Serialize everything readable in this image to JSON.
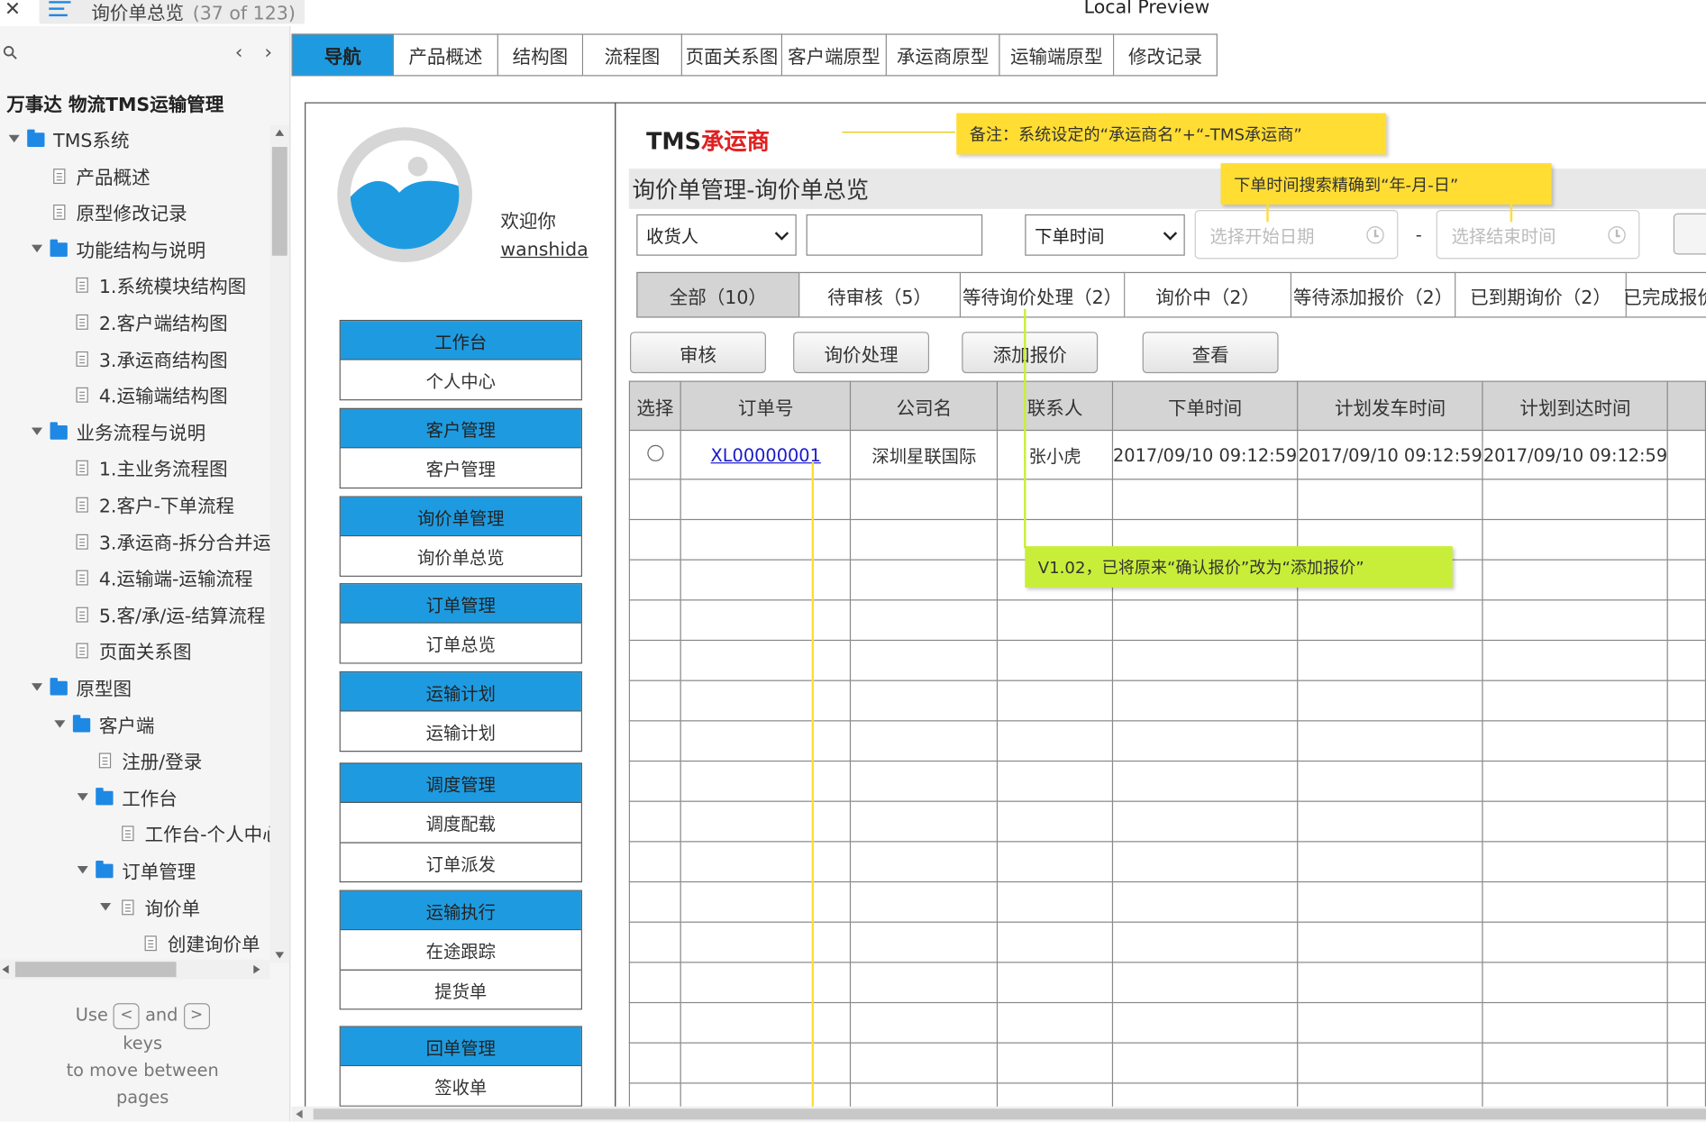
{
  "window": {
    "tab_title": "询价单总览",
    "tab_counter": "(37 of 123)",
    "app_title": "Local Preview"
  },
  "sidebar": {
    "project_title": "万事达 物流TMS运输管理",
    "hint_use": "Use",
    "hint_and": "and",
    "hint_keys": "keys",
    "hint_move": "to move between",
    "hint_pages": "pages",
    "key_prev": "<",
    "key_next": ">",
    "tree": [
      {
        "label": "TMS系统",
        "type": "folder",
        "level": 0,
        "expanded": true
      },
      {
        "label": "产品概述",
        "type": "page",
        "level": 1
      },
      {
        "label": "原型修改记录",
        "type": "page",
        "level": 1
      },
      {
        "label": "功能结构与说明",
        "type": "folder",
        "level": 1,
        "expanded": true
      },
      {
        "label": "1.系统模块结构图",
        "type": "page",
        "level": 2
      },
      {
        "label": "2.客户端结构图",
        "type": "page",
        "level": 2
      },
      {
        "label": "3.承运商结构图",
        "type": "page",
        "level": 2
      },
      {
        "label": "4.运输端结构图",
        "type": "page",
        "level": 2
      },
      {
        "label": "业务流程与说明",
        "type": "folder",
        "level": 1,
        "expanded": true
      },
      {
        "label": "1.主业务流程图",
        "type": "page",
        "level": 2
      },
      {
        "label": "2.客户-下单流程",
        "type": "page",
        "level": 2
      },
      {
        "label": "3.承运商-拆分合并运",
        "type": "page",
        "level": 2
      },
      {
        "label": "4.运输端-运输流程",
        "type": "page",
        "level": 2
      },
      {
        "label": "5.客/承/运-结算流程",
        "type": "page",
        "level": 2
      },
      {
        "label": "页面关系图",
        "type": "page",
        "level": 2
      },
      {
        "label": "原型图",
        "type": "folder",
        "level": 1,
        "expanded": true
      },
      {
        "label": "客户端",
        "type": "folder",
        "level": 2,
        "expanded": true
      },
      {
        "label": "注册/登录",
        "type": "page",
        "level": 3
      },
      {
        "label": "工作台",
        "type": "folder",
        "level": 3,
        "expanded": true
      },
      {
        "label": "工作台-个人中心",
        "type": "page",
        "level": 4
      },
      {
        "label": "订单管理",
        "type": "folder",
        "level": 3,
        "expanded": true
      },
      {
        "label": "询价单",
        "type": "page",
        "level": 4,
        "expanded": true
      },
      {
        "label": "创建询价单",
        "type": "page",
        "level": 5
      }
    ]
  },
  "nav_tabs": [
    "导航",
    "产品概述",
    "结构图",
    "流程图",
    "页面关系图",
    "客户端原型",
    "承运商原型",
    "运输端原型",
    "修改记录"
  ],
  "user": {
    "welcome": "欢迎你",
    "username": "wanshida"
  },
  "left_menu": [
    {
      "head": "工作台",
      "items": [
        "个人中心"
      ]
    },
    {
      "head": "客户管理",
      "items": [
        "客户管理"
      ]
    },
    {
      "head": "询价单管理",
      "items": [
        "询价单总览"
      ]
    },
    {
      "head": "订单管理",
      "items": [
        "订单总览"
      ]
    },
    {
      "head": "运输计划",
      "items": [
        "运输计划"
      ]
    },
    {
      "head": "调度管理",
      "items": [
        "调度配载",
        "订单派发"
      ]
    },
    {
      "head": "运输执行",
      "items": [
        "在途跟踪",
        "提货单"
      ]
    },
    {
      "head": "回单管理",
      "items": [
        "签收单"
      ]
    }
  ],
  "brand": {
    "prefix": "TMS",
    "accent": "承运商"
  },
  "notes": {
    "brand_note": "备注：系统设定的“承运商名”+“-TMS承运商”",
    "date_note": "下单时间搜索精确到“年-月-日”",
    "version_note": "V1.02，已将原来“确认报价”改为“添加报价”"
  },
  "page_heading": "询价单管理-询价单总览",
  "filters": {
    "field_select": "收货人",
    "keyword_value": "",
    "time_select": "下单时间",
    "start_placeholder": "选择开始日期",
    "range_sep": "-",
    "end_placeholder": "选择结束时间"
  },
  "status_tabs": [
    "全部（10）",
    "待审核（5）",
    "等待询价处理（2）",
    "询价中（2）",
    "等待添加报价（2）",
    "已到期询价（2）",
    "已完成报价"
  ],
  "actions": [
    "审核",
    "询价处理",
    "添加报价",
    "查看"
  ],
  "table": {
    "columns": [
      "选择",
      "订单号",
      "公司名",
      "联系人",
      "下单时间",
      "计划发车时间",
      "计划到达时间",
      ""
    ],
    "rows": [
      {
        "order_no": "XL00000001",
        "company": "深圳星联国际",
        "contact": "张小虎",
        "order_time": "2017/09/10  09:12:59",
        "depart_time": "2017/09/10  09:12:59",
        "arrive_time": "2017/09/10  09:12:59"
      }
    ],
    "empty_rows": 16
  },
  "colors": {
    "accent_blue": "#1e9be0",
    "brand_red": "#e02020",
    "note_yellow": "#ffdd33",
    "note_green": "#c9ee3a"
  }
}
